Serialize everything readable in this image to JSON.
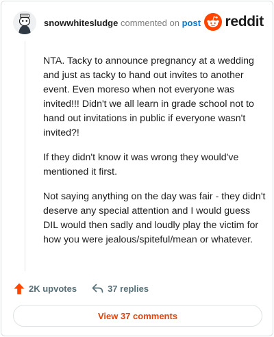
{
  "header": {
    "username": "snowwhitesludge",
    "commented_text": "commented on",
    "post_link": "post",
    "logo_text": "reddit"
  },
  "comment": {
    "paragraphs": [
      "NTA. Tacky to announce pregnancy at a wedding and just as tacky to hand out invites to another event. Even moreso when not everyone was invited!!! Didn't we all learn in grade school not to hand out invitations in public if everyone wasn't invited?!",
      "If they didn't know it was wrong they would've mentioned it first.",
      "Not saying anything on the day was fair - they didn't deserve any special attention and I would guess DIL would then sadly and loudly play the victim for how you were jealous/spiteful/mean or whatever."
    ]
  },
  "actions": {
    "upvotes": "2K upvotes",
    "replies": "37 replies"
  },
  "view_button": "View 37 comments",
  "colors": {
    "reddit_orange": "#ff4500",
    "link_blue": "#0079d3",
    "view_text": "#e0440d"
  },
  "icons": {
    "avatar": "avatar-snoo",
    "logo": "reddit-snoo-icon",
    "upvote": "upvote-arrow-icon",
    "reply": "reply-arrow-icon"
  }
}
